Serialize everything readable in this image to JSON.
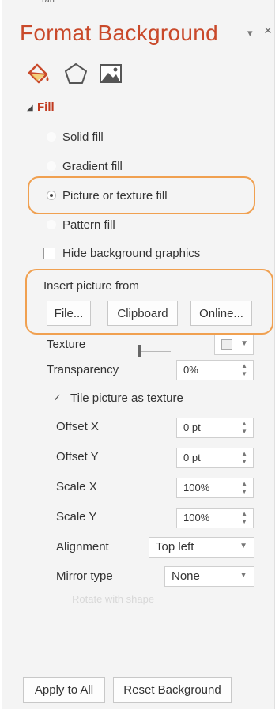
{
  "pane": {
    "cut_label": "ran",
    "title": "Format Background",
    "pin_icon": "pin-icon",
    "close_icon": "close-icon",
    "tab_icons": [
      "fill-bucket-icon",
      "pentagon-effects-icon",
      "picture-icon"
    ],
    "accent_color": "#c9492a",
    "highlight_color": "#f0a050"
  },
  "fill": {
    "section_label": "Fill",
    "options": [
      {
        "label": "Solid fill",
        "checked": false
      },
      {
        "label": "Gradient fill",
        "checked": false
      },
      {
        "label": "Picture or texture fill",
        "checked": true
      },
      {
        "label": "Pattern fill",
        "checked": false
      }
    ],
    "hide_background_graphics": "Hide background graphics",
    "insert_picture_from": "Insert picture from",
    "buttons": {
      "file": "File...",
      "clipboard": "Clipboard",
      "online": "Online..."
    },
    "texture_label": "Texture",
    "transparency_label": "Transparency",
    "transparency_value": "0%",
    "tile_label": "Tile picture as texture",
    "tile_checked": true,
    "offset_x_label": "Offset X",
    "offset_x_value": "0 pt",
    "offset_y_label": "Offset Y",
    "offset_y_value": "0 pt",
    "scale_x_label": "Scale X",
    "scale_x_value": "100%",
    "scale_y_label": "Scale Y",
    "scale_y_value": "100%",
    "alignment_label": "Alignment",
    "alignment_value": "Top left",
    "mirror_label": "Mirror type",
    "mirror_value": "None",
    "rotate_label": "Rotate with shape"
  },
  "footer": {
    "apply_all": "Apply to All",
    "reset": "Reset Background"
  }
}
